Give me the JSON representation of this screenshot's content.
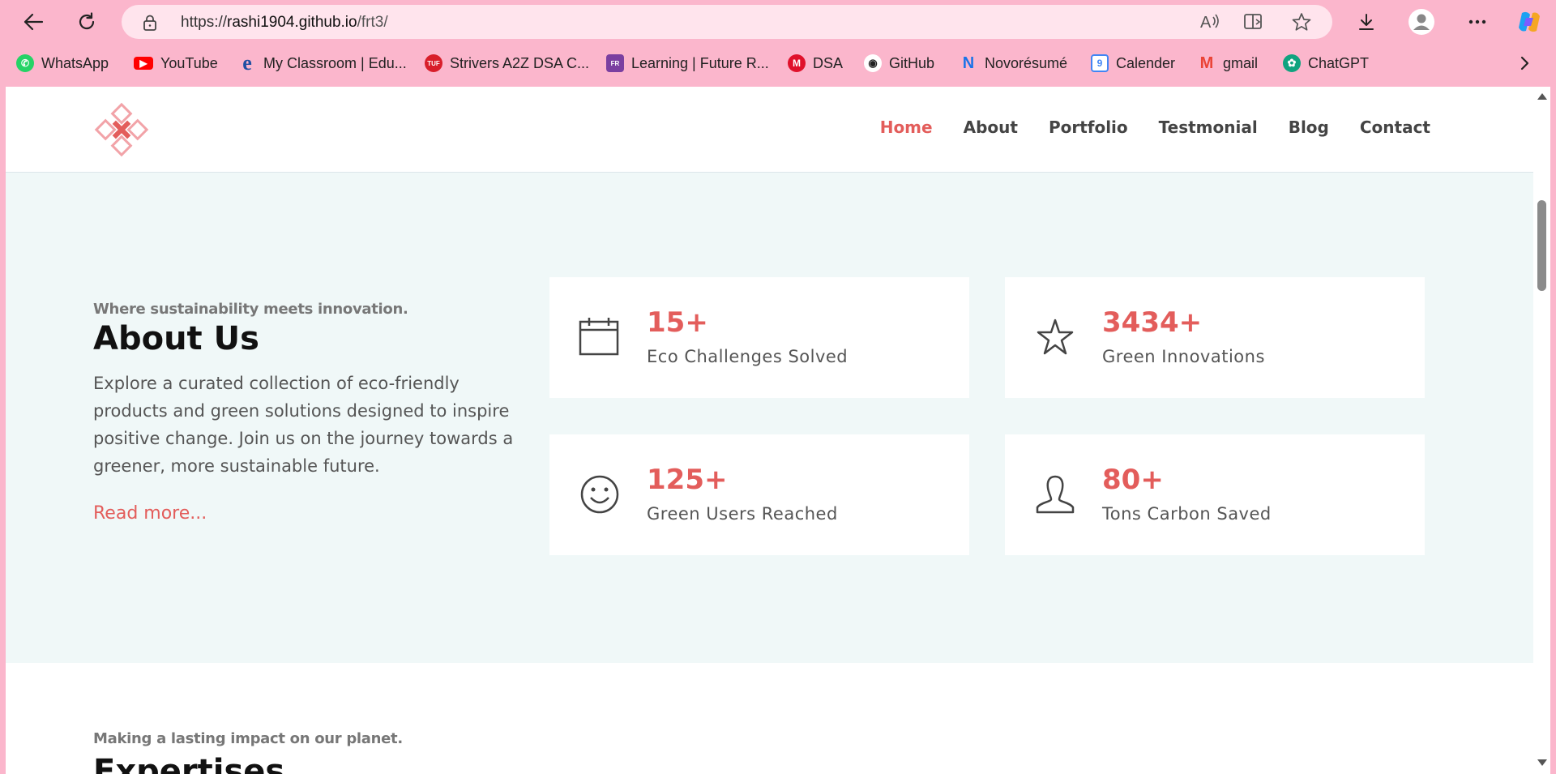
{
  "browser": {
    "url_prefix": "https://",
    "url_host": "rashi1904.github.io",
    "url_path": "/frt3/",
    "bookmarks": [
      {
        "label": "WhatsApp",
        "icon": "whatsapp-icon",
        "color": "#25d366"
      },
      {
        "label": "YouTube",
        "icon": "youtube-icon",
        "color": "#ff0000"
      },
      {
        "label": "My Classroom | Edu...",
        "icon": "edureka-icon",
        "color": "#1f4fa3"
      },
      {
        "label": "Strivers A2Z DSA C...",
        "icon": "tuf-icon",
        "color": "#d81e2a"
      },
      {
        "label": "Learning | Future R...",
        "icon": "future-ready-icon",
        "color": "#7a3fa0"
      },
      {
        "label": "DSA",
        "icon": "dsa-icon",
        "color": "#e0112b"
      },
      {
        "label": "GitHub",
        "icon": "github-icon",
        "color": "#ffffff"
      },
      {
        "label": "Novorésumé",
        "icon": "novoresume-icon",
        "color": "#1a73e8"
      },
      {
        "label": "Calender",
        "icon": "calendar-icon",
        "color": "#4285f4"
      },
      {
        "label": "gmail",
        "icon": "gmail-icon",
        "color": "#ea4335"
      },
      {
        "label": "ChatGPT",
        "icon": "chatgpt-icon",
        "color": "#10a37f"
      }
    ]
  },
  "site": {
    "nav": [
      "Home",
      "About",
      "Portfolio",
      "Testmonial",
      "Blog",
      "Contact"
    ],
    "accent": "#e35d5b",
    "about": {
      "kicker": "Where sustainability meets innovation.",
      "title": "About Us",
      "description": "Explore a curated collection of eco-friendly products and green solutions designed to inspire positive change. Join us on the journey towards a greener, more sustainable future.",
      "read_more": "Read more..."
    },
    "stats": [
      {
        "value": "15+",
        "label": "Eco Challenges Solved",
        "icon": "calendar-icon"
      },
      {
        "value": "3434+",
        "label": "Green Innovations",
        "icon": "star-icon"
      },
      {
        "value": "125+",
        "label": "Green Users Reached",
        "icon": "smiley-icon"
      },
      {
        "value": "80+",
        "label": "Tons Carbon Saved",
        "icon": "user-icon"
      }
    ],
    "expertise": {
      "kicker": "Making a lasting impact on our planet.",
      "title": "Expertises"
    }
  }
}
